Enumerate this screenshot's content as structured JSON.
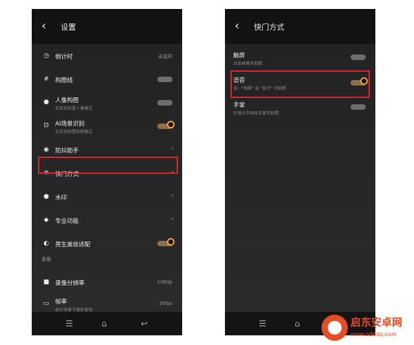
{
  "left_screen": {
    "title": "设置",
    "items": [
      {
        "label": "倒计时",
        "value": "无延时",
        "icon": "timer-icon"
      },
      {
        "label": "构图线",
        "icon": "grid-icon",
        "toggle": "off"
      },
      {
        "label": "人像构图",
        "sub": "仅支持后置人像模式",
        "icon": "person-icon",
        "toggle": "off"
      },
      {
        "label": "AI场景识别",
        "sub": "仅支持后置拍照模式",
        "icon": "ai-scan-icon",
        "toggle": "on"
      },
      {
        "label": "防抖助手",
        "icon": "stabilizer-icon"
      },
      {
        "label": "快门方式",
        "icon": "shutter-icon",
        "highlighted": true
      },
      {
        "label": "水印",
        "icon": "watermark-icon"
      },
      {
        "label": "专业功能",
        "icon": "diamond-icon"
      },
      {
        "label": "男生美妆适配",
        "icon": "makeup-icon",
        "toggle": "on"
      }
    ],
    "section_video": "录像",
    "video_items": [
      {
        "label": "录像分辨率",
        "value": "1080p",
        "icon": "video-camera-icon"
      },
      {
        "label": "帧率",
        "sub": "部分场景下略有波动",
        "value": "30fps",
        "icon": "fps-icon"
      }
    ]
  },
  "right_screen": {
    "title": "快门方式",
    "items": [
      {
        "label": "触屏",
        "sub": "点击屏幕可拍照",
        "toggle": "off"
      },
      {
        "label": "语音",
        "sub": "说：\"拍照\" 或 \"茄子\" 可拍照",
        "toggle": "on",
        "highlighted": true
      },
      {
        "label": "手掌",
        "sub": "在镜头中伸出手掌可拍照",
        "toggle": "off"
      }
    ]
  },
  "nav": {
    "menu_icon": "☰",
    "home_icon": "⌂",
    "back_icon": "↩"
  },
  "watermark": {
    "title": "启东安卓网",
    "url": "www.qdltdq.com"
  },
  "colors": {
    "accent": "#f2a33a",
    "highlight": "#d9262b",
    "watermark": "#e84c22"
  }
}
